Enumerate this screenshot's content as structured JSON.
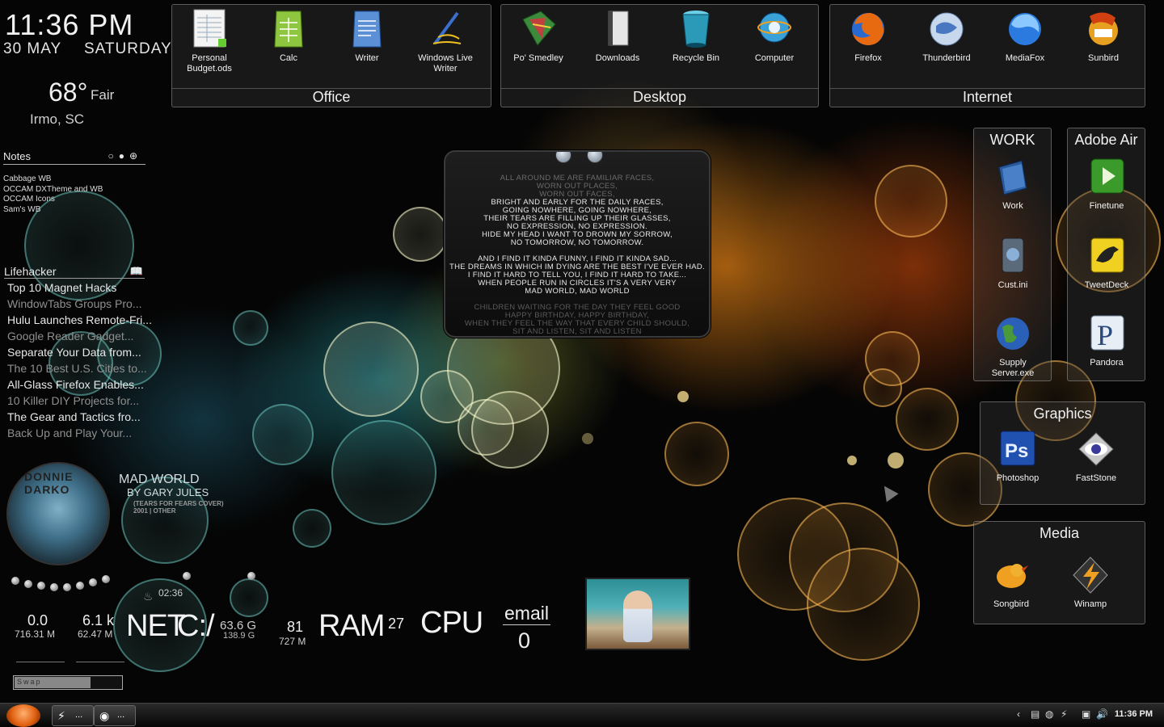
{
  "clock": {
    "time": "11:36 PM",
    "date": "30 MAY",
    "day": "SATURDAY"
  },
  "weather": {
    "temp": "68°",
    "condition": "Fair",
    "location": "Irmo, SC"
  },
  "notes": {
    "title": "Notes",
    "items": [
      "Cabbage WB",
      "OCCAM DXTheme and WB",
      "OCCAM Icons",
      "Sam's WB"
    ]
  },
  "lifehacker": {
    "title": "Lifehacker",
    "items": [
      "Top 10 Magnet Hacks",
      "WindowTabs Groups Pro...",
      "Hulu Launches Remote-Fri...",
      "Google Reader Gadget...",
      "Separate Your Data from...",
      "The 10 Best U.S. Cities to...",
      "All-Glass Firefox Enables...",
      "10 Killer DIY Projects for...",
      "The Gear and Tactics fro...",
      "Back Up and Play Your..."
    ]
  },
  "music": {
    "album_art_text": "DONNIE DARKO",
    "title": "MAD WORLD",
    "artist": "BY GARY JULES",
    "album": "(TEARS FOR FEARS COVER)",
    "year_genre": "2001 | OTHER",
    "time": "02:36"
  },
  "stats": {
    "net_down": "0.0",
    "net_down_total": "716.31 M",
    "net_up": "6.1 k",
    "net_up_total": "62.47 M",
    "net_label": "NET",
    "drive_label": "C:/",
    "drive_free": "63.6 G",
    "drive_total": "138.9 G",
    "ram_pct": "81",
    "ram_used": "727 M",
    "ram_label": "RAM",
    "cpu_pct": "27",
    "cpu_label": "CPU",
    "swap_label": "Swap",
    "swap_fraction": 0.7
  },
  "email": {
    "label": "email",
    "count": "0"
  },
  "lyrics": [
    "ALL AROUND ME ARE FAMILIAR FACES,",
    "WORN OUT PLACES,",
    "WORN OUT FACES,",
    "BRIGHT AND EARLY FOR THE DAILY RACES,",
    "GOING NOWHERE, GOING NOWHERE,",
    "THEIR TEARS ARE FILLING UP THEIR GLASSES,",
    "NO EXPRESSION, NO EXPRESSION.",
    "HIDE MY HEAD I WANT TO DROWN MY SORROW,",
    "NO TOMORROW, NO TOMORROW.",
    "",
    "AND I FIND IT KINDA FUNNY, I FIND IT KINDA SAD...",
    "THE DREAMS IN WHICH IM DYING ARE THE BEST I'VE EVER HAD.",
    "I FIND IT HARD TO TELL YOU, I FIND IT HARD TO TAKE...",
    "WHEN PEOPLE RUN IN CIRCLES IT'S A VERY VERY",
    "MAD WORLD, MAD WORLD",
    "",
    "CHILDREN WAITING FOR THE DAY THEY FEEL GOOD",
    "HAPPY BIRTHDAY, HAPPY BIRTHDAY,",
    "WHEN THEY FEEL THE WAY THAT EVERY CHILD SHOULD,",
    "SIT AND LISTEN, SIT AND LISTEN"
  ],
  "panels": {
    "office": {
      "title": "Office",
      "items": [
        "Personal\nBudget.ods",
        "Calc",
        "Writer",
        "Windows Live\nWriter"
      ]
    },
    "desktop": {
      "title": "Desktop",
      "items": [
        "Po' Smedley",
        "Downloads",
        "Recycle Bin",
        "Computer"
      ]
    },
    "internet": {
      "title": "Internet",
      "items": [
        "Firefox",
        "Thunderbird",
        "MediaFox",
        "Sunbird"
      ]
    },
    "work": {
      "title": "WORK",
      "items": [
        "Work",
        "Cust.ini",
        "Supply\nServer.exe"
      ]
    },
    "adobe": {
      "title": "Adobe Air",
      "items": [
        "Finetune",
        "TweetDeck",
        "Pandora"
      ]
    },
    "graphics": {
      "title": "Graphics",
      "items": [
        "Photoshop",
        "FastStone"
      ]
    },
    "media": {
      "title": "Media",
      "items": [
        "Songbird",
        "Winamp"
      ]
    }
  },
  "taskbar": {
    "buttons": [
      "...",
      "..."
    ],
    "clock": "11:36 PM"
  },
  "colors": {
    "accent_orange": "#e06010",
    "teal": "#3aa8b0"
  }
}
